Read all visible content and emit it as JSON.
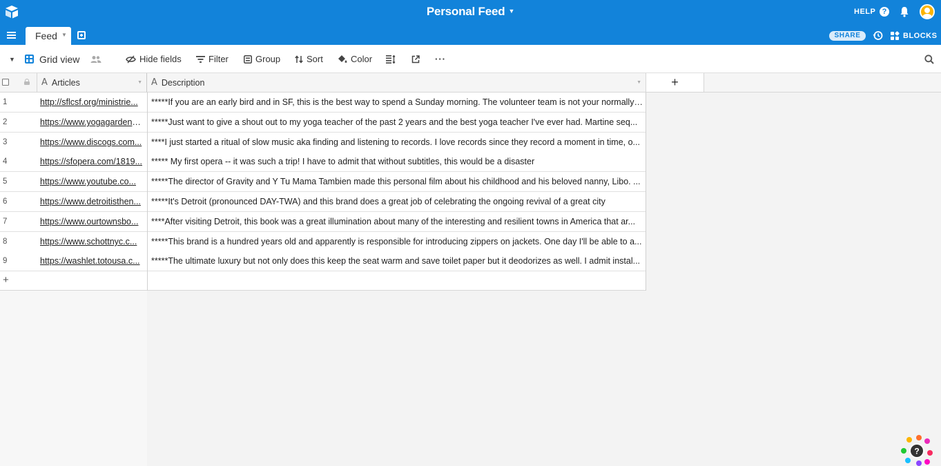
{
  "app": {
    "title": "Personal Feed",
    "help_label": "HELP",
    "share_label": "SHARE",
    "blocks_label": "BLOCKS",
    "brand_color": "#1283da"
  },
  "tabs": [
    {
      "label": "Feed",
      "active": true
    }
  ],
  "viewbar": {
    "view_name": "Grid view",
    "hide_fields_label": "Hide fields",
    "filter_label": "Filter",
    "group_label": "Group",
    "sort_label": "Sort",
    "color_label": "Color",
    "more_label": "···"
  },
  "columns": [
    {
      "name": "Articles",
      "type_icon": "A"
    },
    {
      "name": "Description",
      "type_icon": "A"
    }
  ],
  "add_field_label": "+",
  "add_row_label": "+",
  "rows": [
    {
      "num": "1",
      "article": "http://sflcsf.org/ministrie...",
      "description": "*****If you are an early bird and in SF, this is the best way to spend a Sunday morning. The volunteer team is not your normally ..."
    },
    {
      "num": "2",
      "article": "https://www.yogagardens...",
      "description": "*****Just want to give a shout out to my yoga teacher of the past 2 years and the best yoga teacher I've ever had. Martine seq..."
    },
    {
      "num": "3",
      "article": "https://www.discogs.com...",
      "description": "****I just started a ritual of slow music aka finding and listening to records. I love records since they record a moment in time, o..."
    },
    {
      "num": "4",
      "article": "https://sfopera.com/1819...",
      "description": "***** My first opera -- it was such a trip! I have to admit that without subtitles, this would be a disaster"
    },
    {
      "num": "5",
      "article": "https://www.youtube.co...",
      "description": "*****The director of Gravity and Y Tu Mama Tambien made this personal film about his childhood and his beloved nanny, Libo. ..."
    },
    {
      "num": "6",
      "article": "https://www.detroitisthen...",
      "description": "*****It's Detroit (pronounced DAY-TWA) and this brand does a great job of celebrating the ongoing revival of a great city"
    },
    {
      "num": "7",
      "article": "https://www.ourtownsbo...",
      "description": "****After visiting Detroit, this book was a great illumination about many of the interesting and resilient towns in America that ar..."
    },
    {
      "num": "8",
      "article": "https://www.schottnyc.c...",
      "description": "*****This brand is a hundred years old and apparently is responsible for introducing zippers on jackets. One day I'll be able to a..."
    },
    {
      "num": "9",
      "article": "https://washlet.totousa.c...",
      "description": "*****The ultimate luxury but not only does this keep the seat warm and save toilet paper but it deodorizes as well. I admit instal..."
    }
  ]
}
